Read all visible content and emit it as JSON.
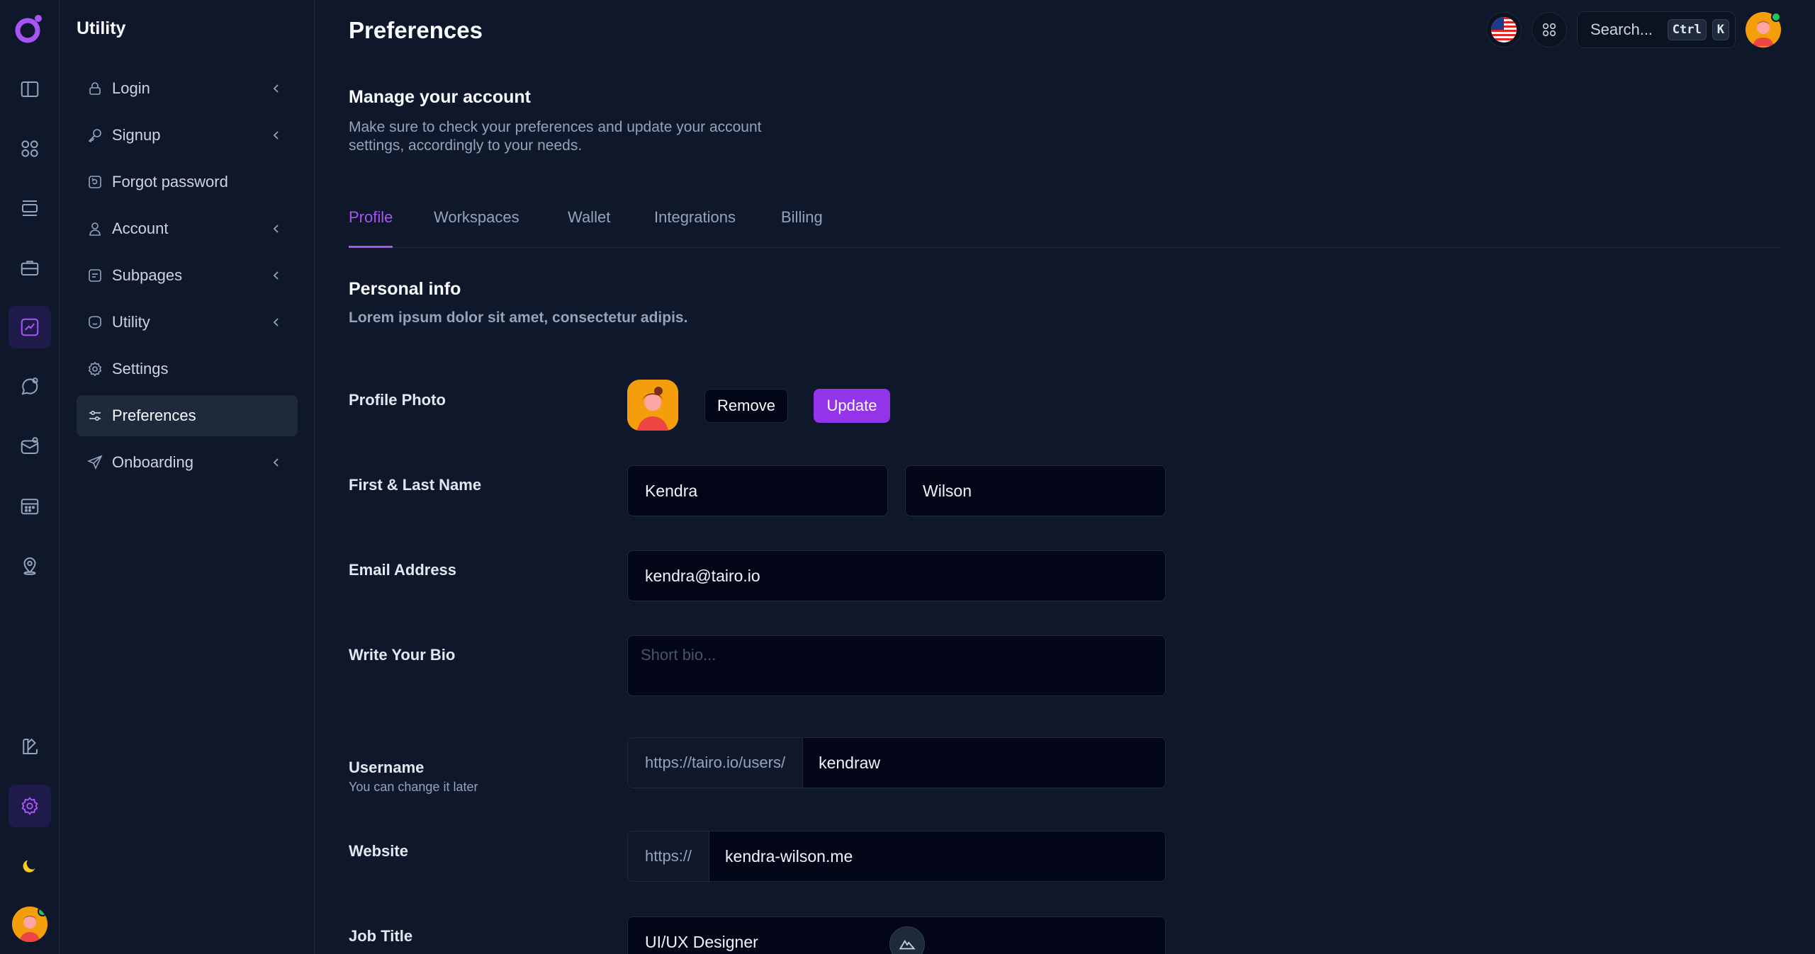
{
  "nav": {
    "title": "Utility",
    "items": [
      {
        "label": "Login",
        "icon": "lock-icon",
        "has_children": true
      },
      {
        "label": "Signup",
        "icon": "key-icon",
        "has_children": true
      },
      {
        "label": "Forgot password",
        "icon": "recover-icon",
        "has_children": false
      },
      {
        "label": "Account",
        "icon": "user-icon",
        "has_children": true
      },
      {
        "label": "Subpages",
        "icon": "document-icon",
        "has_children": true
      },
      {
        "label": "Utility",
        "icon": "shield-icon",
        "has_children": true
      },
      {
        "label": "Settings",
        "icon": "gear-icon",
        "has_children": false
      },
      {
        "label": "Preferences",
        "icon": "sliders-icon",
        "has_children": false,
        "active": true
      },
      {
        "label": "Onboarding",
        "icon": "send-icon",
        "has_children": true
      }
    ]
  },
  "rail": {
    "icons": [
      "sidebar-icon",
      "grid-icon",
      "layout-icon",
      "briefcase-icon",
      "chart-icon",
      "chat-icon",
      "inbox-icon",
      "calendar-icon",
      "map-pin-icon",
      "brush-icon",
      "gear-icon",
      "moon-icon"
    ],
    "active": "chart-icon"
  },
  "header": {
    "title": "Preferences",
    "search_label": "Search...",
    "kbd_ctrl": "Ctrl",
    "kbd_k": "K"
  },
  "intro": {
    "heading": "Manage your account",
    "text_line1": "Make sure to check your preferences and update your account",
    "text_line2": "settings, accordingly to your needs."
  },
  "tabs": [
    {
      "label": "Profile",
      "active": true
    },
    {
      "label": "Workspaces"
    },
    {
      "label": "Wallet"
    },
    {
      "label": "Integrations"
    },
    {
      "label": "Billing"
    }
  ],
  "personal": {
    "heading": "Personal info",
    "text": "Lorem ipsum dolor sit amet, consectetur adipis."
  },
  "form": {
    "photo_label": "Profile Photo",
    "remove_label": "Remove",
    "update_label": "Update",
    "name_label": "First & Last Name",
    "first_name": "Kendra",
    "last_name": "Wilson",
    "email_label": "Email Address",
    "email": "kendra@tairo.io",
    "bio_label": "Write Your Bio",
    "bio_placeholder": "Short bio...",
    "username_label": "Username",
    "username_hint": "You can change it later",
    "username_prefix": "https://tairo.io/users/",
    "username": "kendraw",
    "website_label": "Website",
    "website_prefix": "https://",
    "website": "kendra-wilson.me",
    "job_label": "Job Title",
    "job_title": "UI/UX Designer"
  },
  "colors": {
    "accent": "#a855f7",
    "button": "#9333ea",
    "background": "#0f172a"
  }
}
